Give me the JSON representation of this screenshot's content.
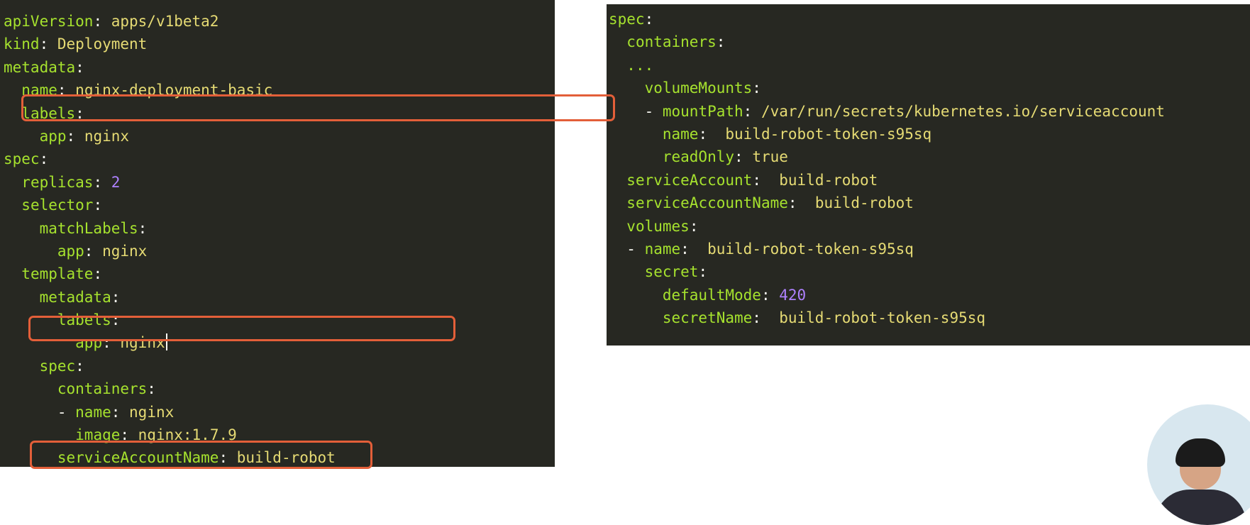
{
  "left_code": {
    "lines": [
      {
        "indent": 0,
        "key": "apiVersion",
        "sep": ": ",
        "value": "apps/v1beta2",
        "vtype": "str"
      },
      {
        "indent": 0,
        "key": "kind",
        "sep": ": ",
        "value": "Deployment",
        "vtype": "str"
      },
      {
        "indent": 0,
        "key": "metadata",
        "sep": ":",
        "value": "",
        "vtype": "none"
      },
      {
        "indent": 2,
        "key": "name",
        "sep": ": ",
        "value": "nginx-deployment-basic",
        "vtype": "str"
      },
      {
        "indent": 2,
        "key": "labels",
        "sep": ":",
        "value": "",
        "vtype": "none"
      },
      {
        "indent": 4,
        "key": "app",
        "sep": ": ",
        "value": "nginx",
        "vtype": "str"
      },
      {
        "indent": 0,
        "key": "spec",
        "sep": ":",
        "value": "",
        "vtype": "none"
      },
      {
        "indent": 2,
        "key": "replicas",
        "sep": ": ",
        "value": "2",
        "vtype": "num"
      },
      {
        "indent": 2,
        "key": "selector",
        "sep": ":",
        "value": "",
        "vtype": "none"
      },
      {
        "indent": 4,
        "key": "matchLabels",
        "sep": ":",
        "value": "",
        "vtype": "none"
      },
      {
        "indent": 6,
        "key": "app",
        "sep": ": ",
        "value": "nginx",
        "vtype": "str"
      },
      {
        "indent": 2,
        "key": "template",
        "sep": ":",
        "value": "",
        "vtype": "none"
      },
      {
        "indent": 4,
        "key": "metadata",
        "sep": ":",
        "value": "",
        "vtype": "none"
      },
      {
        "indent": 6,
        "key": "labels",
        "sep": ":",
        "value": "",
        "vtype": "none"
      },
      {
        "indent": 8,
        "key": "app",
        "sep": ": ",
        "value": "nginx",
        "vtype": "str",
        "cursor": true
      },
      {
        "indent": 4,
        "key": "spec",
        "sep": ":",
        "value": "",
        "vtype": "none"
      },
      {
        "indent": 6,
        "key": "containers",
        "sep": ":",
        "value": "",
        "vtype": "none"
      },
      {
        "indent": 6,
        "dash": "- ",
        "key": "name",
        "sep": ": ",
        "value": "nginx",
        "vtype": "str"
      },
      {
        "indent": 8,
        "key": "image",
        "sep": ": ",
        "value": "nginx:1.7.9",
        "vtype": "str"
      },
      {
        "indent": 6,
        "key": "serviceAccountName",
        "sep": ": ",
        "value": "build-robot",
        "vtype": "str"
      }
    ]
  },
  "right_code": {
    "lines": [
      {
        "indent": 0,
        "key": "spec",
        "sep": ":",
        "value": "",
        "vtype": "none"
      },
      {
        "indent": 2,
        "key": "containers",
        "sep": ":",
        "value": "",
        "vtype": "none"
      },
      {
        "indent": 2,
        "key": "...",
        "sep": "",
        "value": "",
        "vtype": "none"
      },
      {
        "indent": 4,
        "key": "volumeMounts",
        "sep": ":",
        "value": "",
        "vtype": "none"
      },
      {
        "indent": 4,
        "dash": "- ",
        "key": "mountPath",
        "sep": ": ",
        "value": "/var/run/secrets/kubernetes.io/serviceaccount",
        "vtype": "str"
      },
      {
        "indent": 6,
        "key": "name",
        "sep": ":  ",
        "value": "build-robot-token-s95sq",
        "vtype": "str"
      },
      {
        "indent": 6,
        "key": "readOnly",
        "sep": ": ",
        "value": "true",
        "vtype": "kw"
      },
      {
        "indent": 2,
        "key": "serviceAccount",
        "sep": ":  ",
        "value": "build-robot",
        "vtype": "str"
      },
      {
        "indent": 2,
        "key": "serviceAccountName",
        "sep": ":  ",
        "value": "build-robot",
        "vtype": "str"
      },
      {
        "indent": 2,
        "key": "volumes",
        "sep": ":",
        "value": "",
        "vtype": "none"
      },
      {
        "indent": 2,
        "dash": "- ",
        "key": "name",
        "sep": ":  ",
        "value": "build-robot-token-s95sq",
        "vtype": "str"
      },
      {
        "indent": 4,
        "key": "secret",
        "sep": ":",
        "value": "",
        "vtype": "none"
      },
      {
        "indent": 6,
        "key": "defaultMode",
        "sep": ": ",
        "value": "420",
        "vtype": "num"
      },
      {
        "indent": 6,
        "key": "secretName",
        "sep": ":  ",
        "value": "build-robot-token-s95sq",
        "vtype": "str"
      }
    ]
  },
  "colors": {
    "editor_bg": "#272822",
    "key": "#a6e22e",
    "string": "#e6db74",
    "number": "#ae81ff",
    "text": "#f8f8f2",
    "highlight_border": "#e35f39"
  }
}
